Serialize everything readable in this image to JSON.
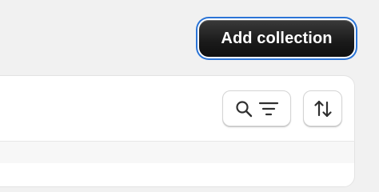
{
  "header": {
    "add_collection_label": "Add collection"
  },
  "toolbar": {
    "search_filter_icons": [
      "search-icon",
      "filter-icon"
    ],
    "sort_icon": "sort-icon"
  },
  "colors": {
    "primary_button_bg": "#1a1a1a",
    "focus_ring": "#2b74d6",
    "page_bg": "#f1f1f1",
    "card_bg": "#ffffff"
  }
}
